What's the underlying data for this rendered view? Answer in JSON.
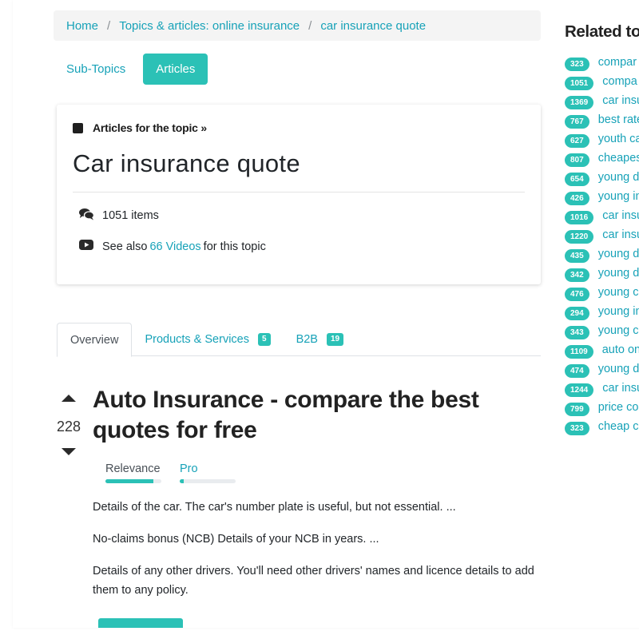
{
  "breadcrumb": {
    "items": [
      "Home",
      "Topics & articles: online insurance",
      "car insurance quote"
    ],
    "separator": "/"
  },
  "subnav": {
    "items": [
      "Sub-Topics",
      "Articles"
    ],
    "active": "Articles"
  },
  "topic_card": {
    "kicker": "Articles for the topic »",
    "title": "Car insurance quote",
    "items_count": "1051 items",
    "see_also_prefix": "See also",
    "videos_link": "66 Videos",
    "see_also_suffix": "for this topic"
  },
  "tabs": [
    {
      "label": "Overview",
      "badge": null
    },
    {
      "label": "Products & Services",
      "badge": "5"
    },
    {
      "label": "B2B",
      "badge": "19"
    }
  ],
  "article": {
    "votes": "228",
    "title": "Auto Insurance - compare the best quotes for free",
    "meters": [
      {
        "label": "Relevance",
        "value": 0.86
      },
      {
        "label": "Pro",
        "value": 0.07
      }
    ],
    "paragraphs": [
      "Details of the car. The car's number plate is useful, but not essential. ...",
      "No-claims bonus (NCB) Details of your NCB in years. ...",
      "Details of any other drivers. You'll need other drivers' names and licence details to add them to any policy."
    ]
  },
  "related": {
    "heading": "Related to",
    "items": [
      {
        "count": "323",
        "label": "compar"
      },
      {
        "count": "1051",
        "label": "compa"
      },
      {
        "count": "1369",
        "label": "car insu"
      },
      {
        "count": "767",
        "label": "best rate"
      },
      {
        "count": "627",
        "label": "youth ca"
      },
      {
        "count": "807",
        "label": "cheapes"
      },
      {
        "count": "654",
        "label": "young d"
      },
      {
        "count": "426",
        "label": "young in"
      },
      {
        "count": "1016",
        "label": "car insu"
      },
      {
        "count": "1220",
        "label": "car insu"
      },
      {
        "count": "435",
        "label": "young d"
      },
      {
        "count": "342",
        "label": "young d"
      },
      {
        "count": "476",
        "label": "young c"
      },
      {
        "count": "294",
        "label": "young in"
      },
      {
        "count": "343",
        "label": "young c"
      },
      {
        "count": "1109",
        "label": "auto on"
      },
      {
        "count": "474",
        "label": "young d"
      },
      {
        "count": "1244",
        "label": "car insu"
      },
      {
        "count": "799",
        "label": "price co"
      },
      {
        "count": "323",
        "label": "cheap c"
      }
    ]
  },
  "colors": {
    "accent": "#2bc1b6",
    "link": "#17a2b8"
  }
}
